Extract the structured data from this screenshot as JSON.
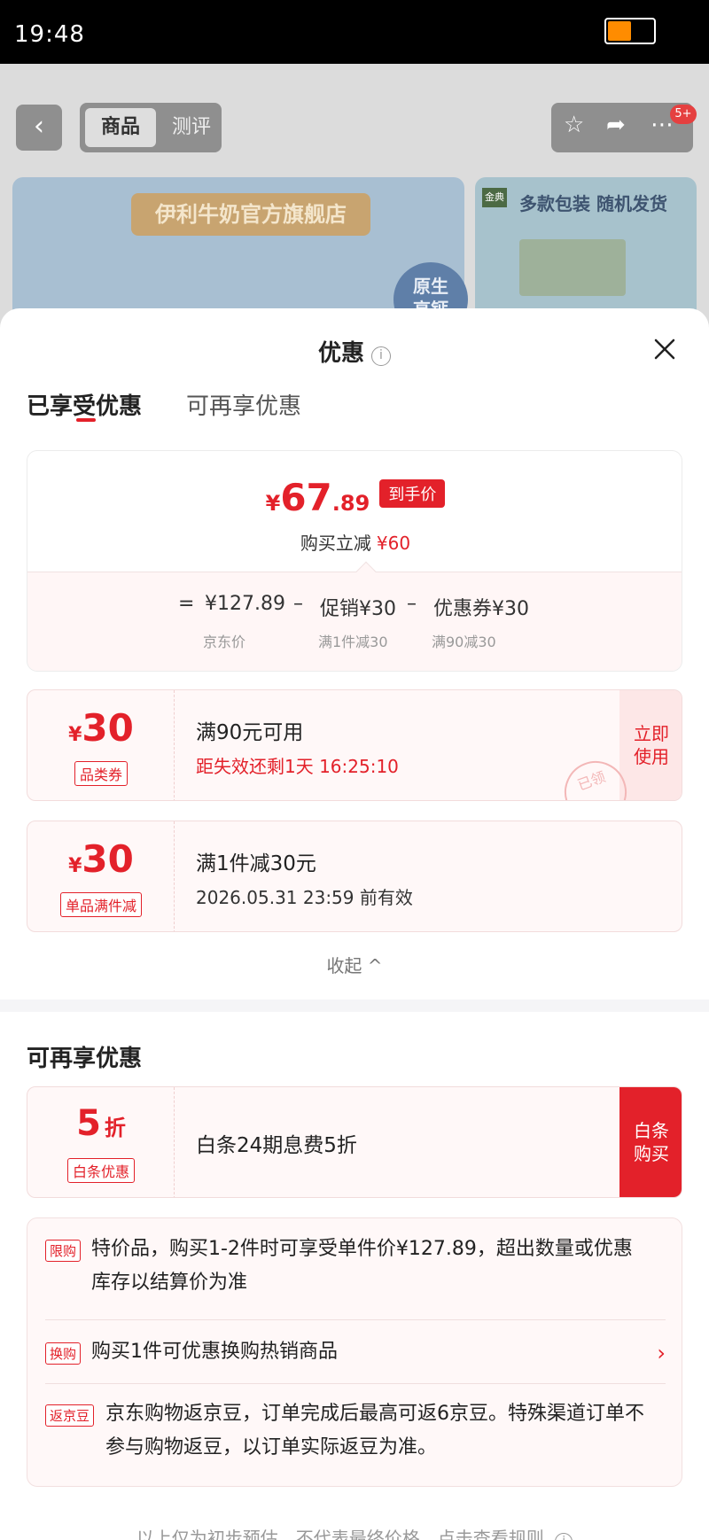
{
  "status_bar": {
    "time": "19:48"
  },
  "background_page": {
    "tabs": [
      "商品",
      "测评"
    ],
    "badge": "5+",
    "store_name": "伊利牛奶官方旗舰店",
    "seal_text": "原生\n高钙",
    "brand_logo": "金典",
    "promo_text": "多款包装 随机发货"
  },
  "sheet": {
    "title": "优惠",
    "tabs": {
      "active": "已享受优惠",
      "other": "可再享优惠"
    },
    "price_card": {
      "currency": "¥",
      "price_int": "67",
      "price_dec": ".89",
      "price_tag": "到手价",
      "instant_label": "购买立减",
      "instant_amount": "¥60",
      "formula": {
        "eq": "=",
        "base": "¥127.89",
        "minus": "–",
        "promo": "促销¥30",
        "coupon": "优惠券¥30"
      },
      "labels": {
        "base": "京东价",
        "promo": "满1件减30",
        "coupon": "满90减30"
      }
    },
    "coupons": [
      {
        "currency": "¥",
        "amount": "30",
        "label": "品类券",
        "title": "满90元可用",
        "detail": "距失效还剩1天 16:25:10",
        "action": "立即\n使用",
        "stamp": "已领"
      },
      {
        "currency": "¥",
        "amount": "30",
        "label": "单品满件减",
        "title": "满1件减30元",
        "detail": "2026.05.31 23:59 前有效"
      }
    ],
    "collapse_label": "收起 ^",
    "more_section": {
      "title": "可再享优惠",
      "baitiao": {
        "amount": "5",
        "unit": "折",
        "label": "白条优惠",
        "title": "白条24期息费5折",
        "action": "白条\n购买"
      },
      "info_rows": [
        {
          "badge": "限购",
          "text": "特价品，购买1-2件时可享受单件价¥127.89，超出数量或优惠库存以结算价为准"
        },
        {
          "badge": "换购",
          "text": "购买1件可优惠换购热销商品"
        },
        {
          "badge": "返京豆",
          "text": "京东购物返京豆，订单完成后最高可返6京豆。特殊渠道订单不参与购物返豆，以订单实际返豆为准。"
        }
      ]
    },
    "footer": "以上仅为初步预估，不代表最终价格，点击查看规则"
  }
}
